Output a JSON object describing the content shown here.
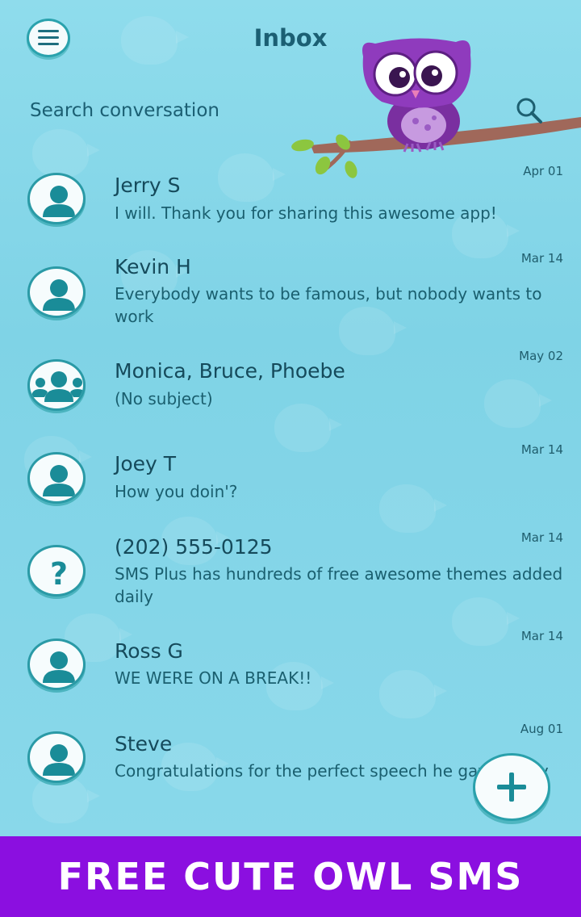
{
  "header": {
    "title": "Inbox"
  },
  "search": {
    "placeholder": "Search conversation"
  },
  "conversations": [
    {
      "name": "Jerry S",
      "date": "Apr 01",
      "snippet": " I will. Thank you for sharing this awesome app!",
      "avatar": "person-icon"
    },
    {
      "name": "Kevin H",
      "date": "Mar 14",
      "snippet": " Everybody wants to be famous, but nobody wants to work",
      "avatar": "person-icon"
    },
    {
      "name": "Monica, Bruce, Phoebe",
      "date": "May 02",
      "snippet": "(No subject)",
      "avatar": "group-icon"
    },
    {
      "name": "Joey T",
      "date": "Mar 14",
      "snippet": " How you doin'?",
      "avatar": "person-icon"
    },
    {
      "name": "(202) 555-0125",
      "date": "Mar 14",
      "snippet": " SMS Plus has hundreds of free awesome themes added daily",
      "avatar": "question-icon"
    },
    {
      "name": "Ross G",
      "date": "Mar 14",
      "snippet": " WE WERE ON A BREAK!!",
      "avatar": "person-icon"
    },
    {
      "name": "Steve",
      "date": "Aug 01",
      "snippet": "Congratulations for the perfect speech he gave today",
      "avatar": "person-icon"
    }
  ],
  "banner": {
    "text": "FREE CUTE OWL SMS"
  },
  "colors": {
    "accent": "#2aa2ad",
    "banner": "#8b0fe0",
    "text": "#154a5b",
    "background": "#7fd4e6"
  }
}
